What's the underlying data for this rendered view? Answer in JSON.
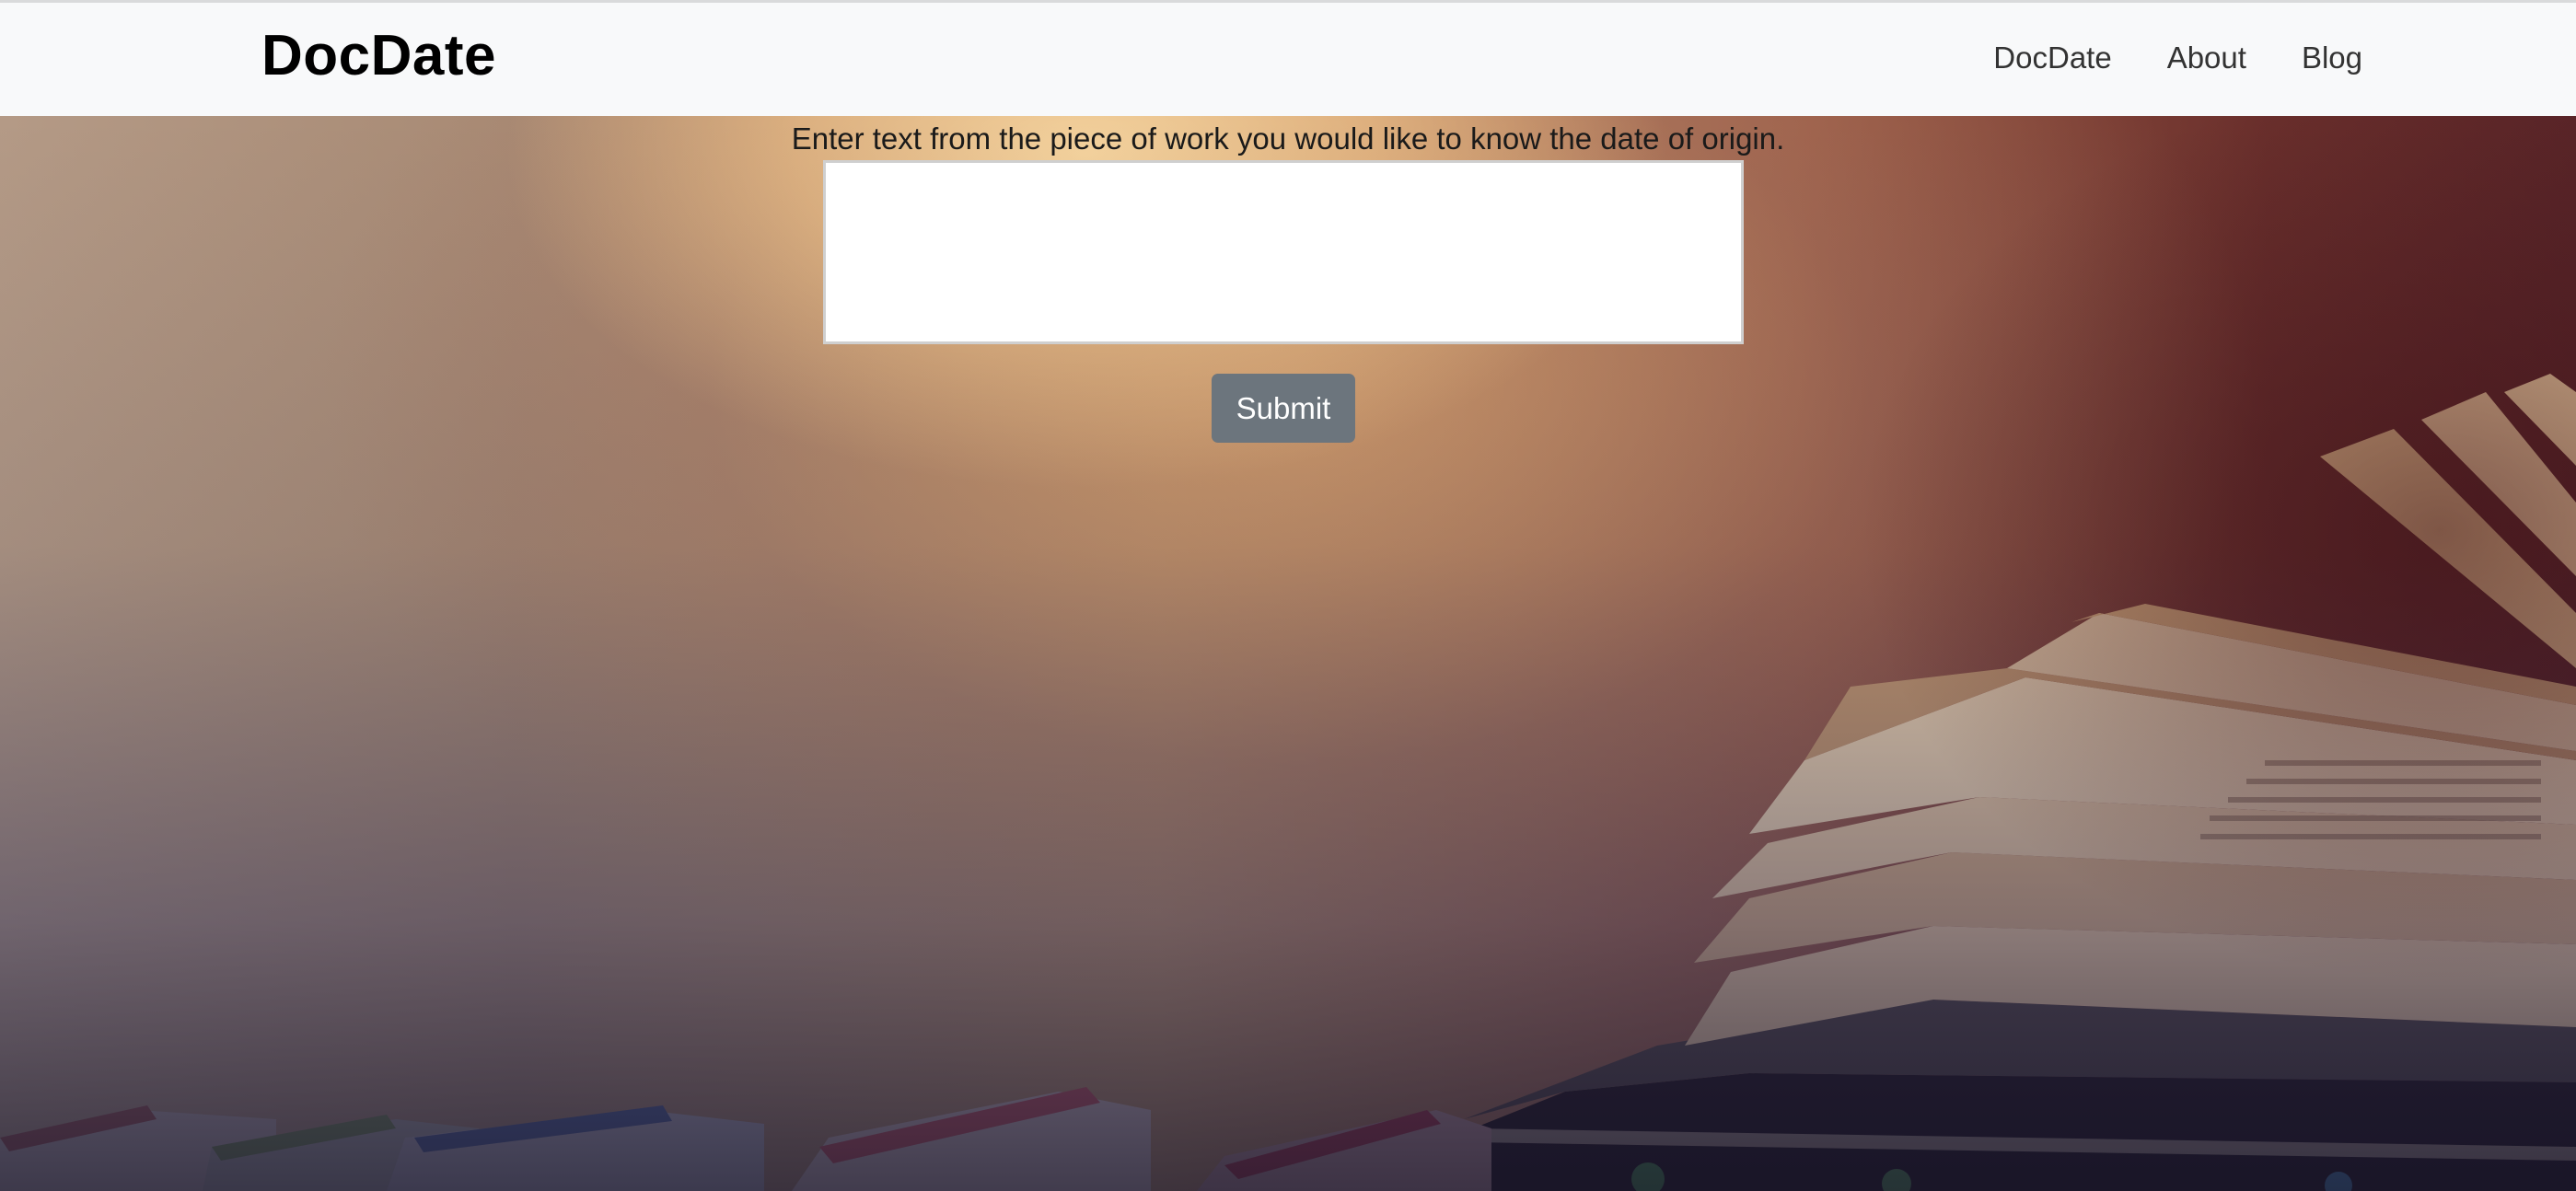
{
  "navbar": {
    "brand": "DocDate",
    "links": [
      "DocDate",
      "About",
      "Blog"
    ],
    "background": "#f8f9fa"
  },
  "form": {
    "prompt": "Enter text from the piece of work you would like to know the date of origin.",
    "textarea_value": "",
    "submit_label": "Submit",
    "submit_color": "#6c757d"
  },
  "background_image": {
    "subject": "open books",
    "icon": "books-background"
  }
}
